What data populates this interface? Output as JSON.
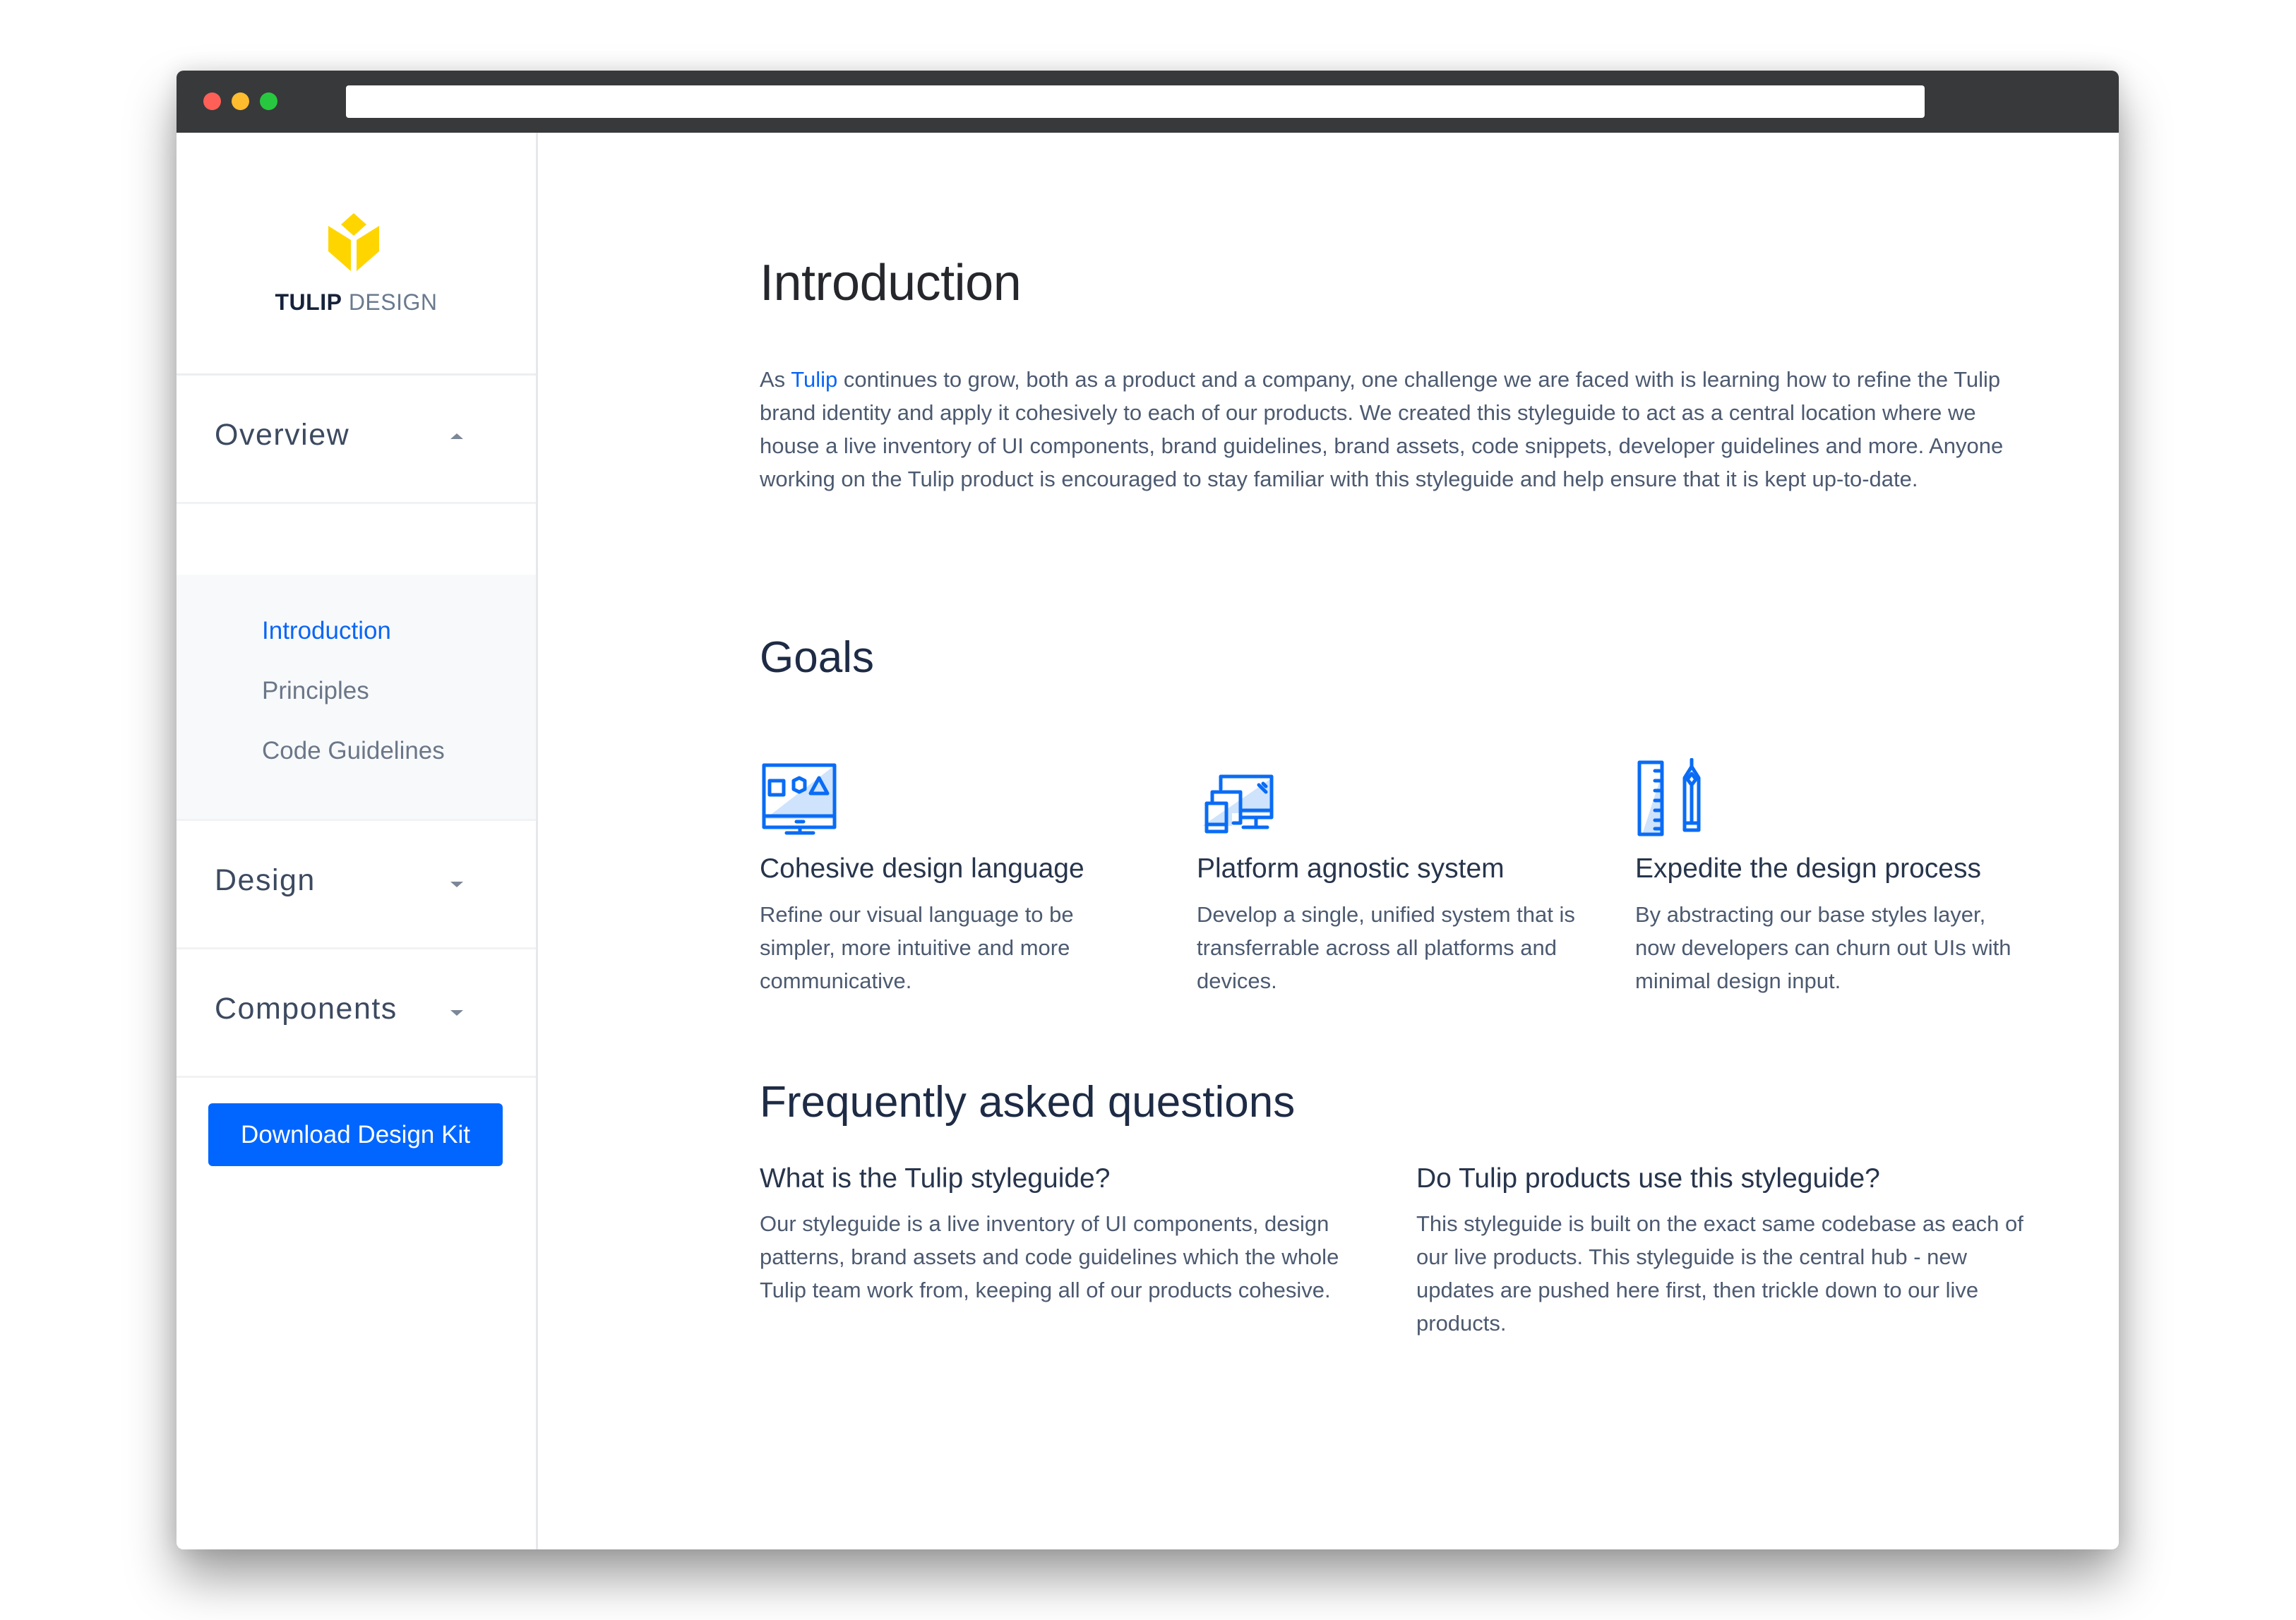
{
  "browser": {
    "controls": [
      "close",
      "minimize",
      "maximize"
    ],
    "url": ""
  },
  "brand": {
    "name_strong": "TULIP",
    "name_light": " DESIGN",
    "logo_color": "#ffd500",
    "accent": "#0066ff"
  },
  "sidebar": {
    "sections": [
      {
        "label": "Overview",
        "expanded": true,
        "caret": "caret-up-icon"
      },
      {
        "label": "Design",
        "expanded": false,
        "caret": "caret-down-icon"
      },
      {
        "label": "Components",
        "expanded": false,
        "caret": "caret-down-icon"
      }
    ],
    "overview_items": [
      {
        "label": "Introduction",
        "active": true
      },
      {
        "label": "Principles",
        "active": false
      },
      {
        "label": "Code Guidelines",
        "active": false
      }
    ],
    "download_button": "Download Design Kit"
  },
  "main": {
    "title": "Introduction",
    "intro": {
      "prefix": "As ",
      "link": "Tulip",
      "text": " continues to grow, both as a product and a company, one challenge we are faced with is learning how to refine the Tulip brand identity and apply it cohesively to each of our products. We created this styleguide to act as a central location where we house a live inventory of UI components, brand guidelines, brand assets, code snippets, developer guidelines and more. Anyone working on the Tulip product is encouraged to stay familiar with this styleguide and help ensure that it is kept up-to-date."
    },
    "goals_title": "Goals",
    "goals": [
      {
        "icon": "monitor-shapes-icon",
        "title": "Cohesive design language",
        "text": "Refine our visual language to be simpler, more intuitive and more communicative."
      },
      {
        "icon": "devices-icon",
        "title": "Platform agnostic system",
        "text": "Develop a single, unified system that is transferrable across all platforms and devices."
      },
      {
        "icon": "ruler-pencil-icon",
        "title": "Expedite the design process",
        "text": "By abstracting our base styles layer, now developers can churn out UIs with minimal design input."
      }
    ],
    "faq_title": "Frequently asked questions",
    "faq": [
      {
        "question": "What is the Tulip styleguide?",
        "answer": "Our styleguide is a live inventory of UI components, design patterns, brand assets and code guidelines which the whole Tulip team work from, keeping all of our products cohesive."
      },
      {
        "question": "Do Tulip products use this styleguide?",
        "answer": "This styleguide is built on the exact same codebase as each of our live products. This styleguide is the central hub - new updates are pushed here first, then trickle down to our live products."
      }
    ]
  }
}
